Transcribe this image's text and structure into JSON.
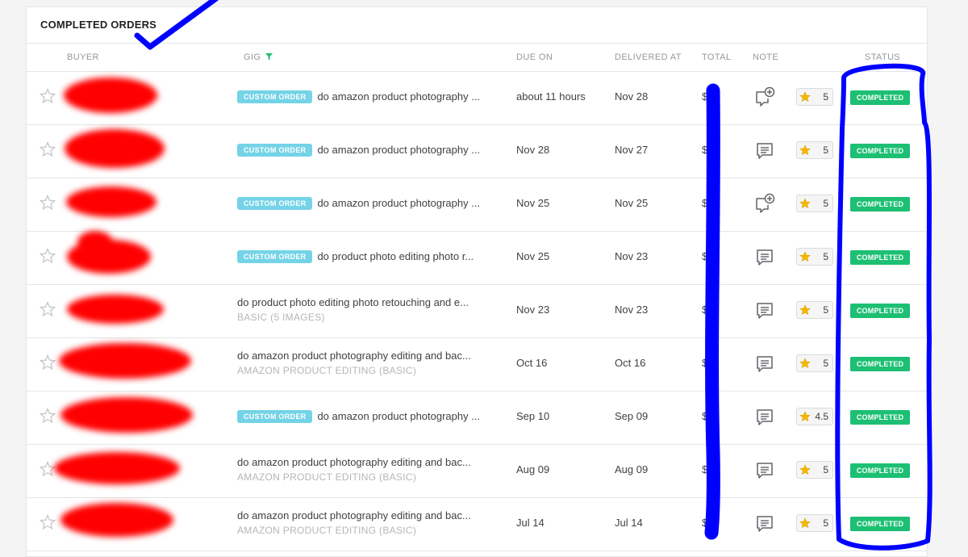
{
  "panel": {
    "title": "COMPLETED ORDERS"
  },
  "columns": {
    "buyer": "BUYER",
    "gig": "GIG",
    "due_on": "DUE ON",
    "delivered_at": "DELIVERED AT",
    "total": "TOTAL",
    "note": "NOTE",
    "status": "STATUS"
  },
  "icons": {
    "star": "star-outline-icon",
    "note_add": "note-add-icon",
    "note": "note-icon",
    "rating_star": "star-filled-icon",
    "filter": "filter-icon"
  },
  "colors": {
    "status_green": "#1dbf73",
    "badge_teal": "#74d3e6",
    "filter_green": "#1dbf73",
    "rating_star": "#f5b800",
    "redaction_red": "#ff0000",
    "annotation_blue": "#0000ff"
  },
  "orders": [
    {
      "badge": "CUSTOM ORDER",
      "gig_title": "do amazon product photography ...",
      "package": "",
      "due": "about 11 hours",
      "delivered": "Nov 28",
      "total": "$",
      "note_icon": "note-add-icon",
      "rating": "5",
      "status": "COMPLETED"
    },
    {
      "badge": "CUSTOM ORDER",
      "gig_title": "do amazon product photography ...",
      "package": "",
      "due": "Nov 28",
      "delivered": "Nov 27",
      "total": "$",
      "note_icon": "note-icon",
      "rating": "5",
      "status": "COMPLETED"
    },
    {
      "badge": "CUSTOM ORDER",
      "gig_title": "do amazon product photography ...",
      "package": "",
      "due": "Nov 25",
      "delivered": "Nov 25",
      "total": "$",
      "note_icon": "note-add-icon",
      "rating": "5",
      "status": "COMPLETED"
    },
    {
      "badge": "CUSTOM ORDER",
      "gig_title": "do product photo editing photo r...",
      "package": "",
      "due": "Nov 25",
      "delivered": "Nov 23",
      "total": "$",
      "note_icon": "note-icon",
      "rating": "5",
      "status": "COMPLETED"
    },
    {
      "badge": "",
      "gig_title": "do product photo editing photo retouching and e...",
      "package": "BASIC (5 IMAGES)",
      "due": "Nov 23",
      "delivered": "Nov 23",
      "total": "$",
      "note_icon": "note-icon",
      "rating": "5",
      "status": "COMPLETED"
    },
    {
      "badge": "",
      "gig_title": "do amazon product photography editing and bac...",
      "package": "AMAZON PRODUCT EDITING (BASIC)",
      "due": "Oct 16",
      "delivered": "Oct 16",
      "total": "$",
      "note_icon": "note-icon",
      "rating": "5",
      "status": "COMPLETED"
    },
    {
      "badge": "CUSTOM ORDER",
      "gig_title": "do amazon product photography ...",
      "package": "",
      "due": "Sep 10",
      "delivered": "Sep 09",
      "total": "$",
      "note_icon": "note-icon",
      "rating": "4.5",
      "status": "COMPLETED"
    },
    {
      "badge": "",
      "gig_title": "do amazon product photography editing and bac...",
      "package": "AMAZON PRODUCT EDITING (BASIC)",
      "due": "Aug 09",
      "delivered": "Aug 09",
      "total": "$",
      "note_icon": "note-icon",
      "rating": "5",
      "status": "COMPLETED"
    },
    {
      "badge": "",
      "gig_title": "do amazon product photography editing and bac...",
      "package": "AMAZON PRODUCT EDITING (BASIC)",
      "due": "Jul 14",
      "delivered": "Jul 14",
      "total": "$",
      "note_icon": "note-icon",
      "rating": "5",
      "status": "COMPLETED"
    }
  ]
}
